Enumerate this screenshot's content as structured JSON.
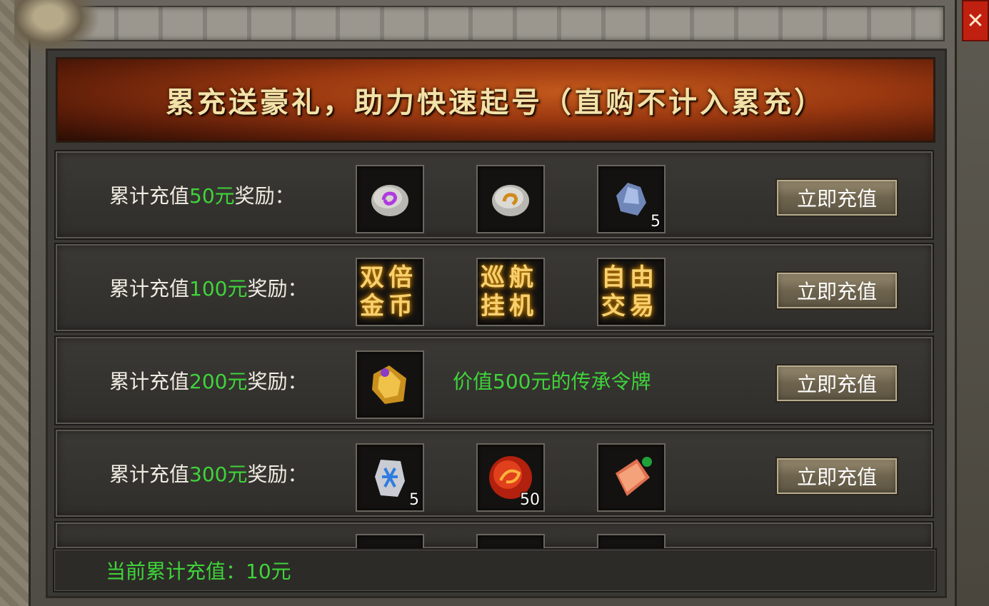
{
  "window": {
    "close_label": "✕"
  },
  "banner": {
    "title": "累充送豪礼，助力快速起号（直购不计入累充）"
  },
  "rows": [
    {
      "label_prefix": "累计充值",
      "amount": "50元",
      "label_suffix": "奖励：",
      "button": "立即充值",
      "items": [
        {
          "icon": "purple-rune-stone-icon",
          "count": ""
        },
        {
          "icon": "gold-rune-stone-icon",
          "count": ""
        },
        {
          "icon": "blue-crystal-ore-icon",
          "count": "5"
        }
      ]
    },
    {
      "label_prefix": "累计充值",
      "amount": "100元",
      "label_suffix": "奖励：",
      "button": "立即充值",
      "items": [
        {
          "icon": "double-gold-badge-icon",
          "text": "双倍金币"
        },
        {
          "icon": "cruise-afk-badge-icon",
          "text": "巡航挂机"
        },
        {
          "icon": "free-trade-badge-icon",
          "text": "自由交易"
        }
      ]
    },
    {
      "label_prefix": "累计充值",
      "amount": "200元",
      "label_suffix": "奖励：",
      "button": "立即充值",
      "note": "价值500元的传承令牌",
      "items": [
        {
          "icon": "gold-token-icon",
          "count": ""
        }
      ]
    },
    {
      "label_prefix": "累计充值",
      "amount": "300元",
      "label_suffix": "奖励：",
      "button": "立即充值",
      "items": [
        {
          "icon": "blue-rune-stone-icon",
          "count": "5"
        },
        {
          "icon": "red-dragon-orb-icon",
          "count": "50"
        },
        {
          "icon": "red-scroll-book-icon",
          "count": ""
        }
      ]
    }
  ],
  "footer": {
    "current_total": "当前累计充值：10元"
  },
  "colors": {
    "accent_green": "#3ed43a",
    "banner_text": "#f2e2a8",
    "close_red": "#c02010"
  }
}
